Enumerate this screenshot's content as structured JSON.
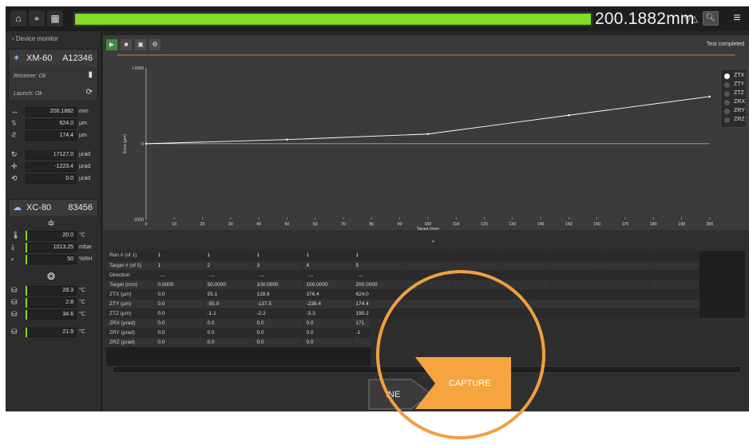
{
  "topbar": {
    "home_icon": "home-icon",
    "target_icon": "crosshair-icon",
    "grid_icon": "grid-icon",
    "progress": 1.0,
    "readout": "200.1882mm",
    "direction_icons": "▽△",
    "accent": "#7fdd26"
  },
  "left": {
    "header": "‹  Device monitor",
    "xm60": {
      "name": "XM-60",
      "serial": "A12346",
      "receiver_label": "Receiver:  Ok",
      "launch_label": "Launch:  Ok",
      "values": [
        {
          "icon": "linear-icon",
          "value": "200.1882",
          "unit": "mm"
        },
        {
          "icon": "straightness-h-icon",
          "value": "624.0",
          "unit": "µm"
        },
        {
          "icon": "straightness-v-icon",
          "value": "174.4",
          "unit": "µm"
        },
        {
          "icon": "pitch-icon",
          "value": "17127.0",
          "unit": "µrad"
        },
        {
          "icon": "yaw-icon",
          "value": "-1223.4",
          "unit": "µrad"
        },
        {
          "icon": "roll-icon",
          "value": "0.0",
          "unit": "µrad"
        }
      ]
    },
    "xc80": {
      "name": "XC-80",
      "serial": "83456",
      "air": [
        {
          "icon": "air-temp-icon",
          "value": "20.0",
          "unit": "°C"
        },
        {
          "icon": "pressure-icon",
          "value": "1013.25",
          "unit": "mbar"
        },
        {
          "icon": "humidity-icon",
          "value": "50",
          "unit": "%RH"
        }
      ],
      "material": [
        {
          "icon": "material-sensor-icon",
          "value": "28.3",
          "unit": "°C"
        },
        {
          "icon": "material-sensor-icon",
          "value": "2.8",
          "unit": "°C"
        },
        {
          "icon": "material-sensor-icon",
          "value": "34.6",
          "unit": "°C"
        },
        {
          "icon": "material-sensor-icon",
          "value": "21.9",
          "unit": "°C"
        }
      ]
    }
  },
  "main": {
    "test_status": "Test completed",
    "legend": [
      "ZTX",
      "ZTY",
      "ZTZ",
      "ZRX",
      "ZRY",
      "ZRZ"
    ],
    "legend_selected": 0
  },
  "chart_data": {
    "type": "line",
    "xlabel": "Target (mm)",
    "ylabel": "Error (µm)",
    "xlim": [
      0,
      200
    ],
    "ylim": [
      -1000,
      1000
    ],
    "x_ticks": [
      0,
      10,
      20,
      30,
      40,
      50,
      60,
      70,
      80,
      90,
      100,
      110,
      120,
      130,
      140,
      150,
      160,
      170,
      180,
      190,
      200
    ],
    "y_ticks": [
      "-1000",
      "0",
      "+1000"
    ],
    "series": [
      {
        "x": [
          0,
          50,
          100,
          150,
          200
        ],
        "y": [
          0,
          55.1,
          128.6,
          376.4,
          624.0
        ],
        "color": "#ffffff"
      }
    ]
  },
  "table": {
    "rows": [
      {
        "label": "Run # (of 1)",
        "cells": [
          "1",
          "1",
          "1",
          "1",
          "1"
        ]
      },
      {
        "label": "Target # (of 5)",
        "cells": [
          "1",
          "2",
          "3",
          "4",
          "5"
        ]
      },
      {
        "label": "Direction",
        "cells": [
          "→",
          "→",
          "→",
          "→",
          "→"
        ],
        "arrow": true
      },
      {
        "label": "Target (mm)",
        "cells": [
          "0.0000",
          "50.0000",
          "100.0000",
          "150.0000",
          "200.0000"
        ]
      },
      {
        "label": "ZTX (µm)",
        "cells": [
          "0.0",
          "55.1",
          "128.6",
          "376.4",
          "624.0"
        ]
      },
      {
        "label": "ZTY (µm)",
        "cells": [
          "0.0",
          "-55.0",
          "-137.5",
          "-238.4",
          "174.4"
        ]
      },
      {
        "label": "ZTZ (µm)",
        "cells": [
          "0.0",
          "-1.1",
          "-2.2",
          "-3.3",
          "190.2"
        ]
      },
      {
        "label": "ZRX (µrad)",
        "cells": [
          "0.0",
          "0.0",
          "0.0",
          "0.0",
          "171"
        ]
      },
      {
        "label": "ZRY (µrad)",
        "cells": [
          "0.0",
          "0.0",
          "0.0",
          "0.0",
          "-1"
        ]
      },
      {
        "label": "ZRZ (µrad)",
        "cells": [
          "0.0",
          "0.0",
          "0.0",
          "0.0",
          ""
        ]
      }
    ]
  },
  "bottom": {
    "baseline_partial": "INE",
    "capture_label": "CAPTURE",
    "capture_color": "#f5a43f",
    "highlight_color": "#f0a040"
  }
}
